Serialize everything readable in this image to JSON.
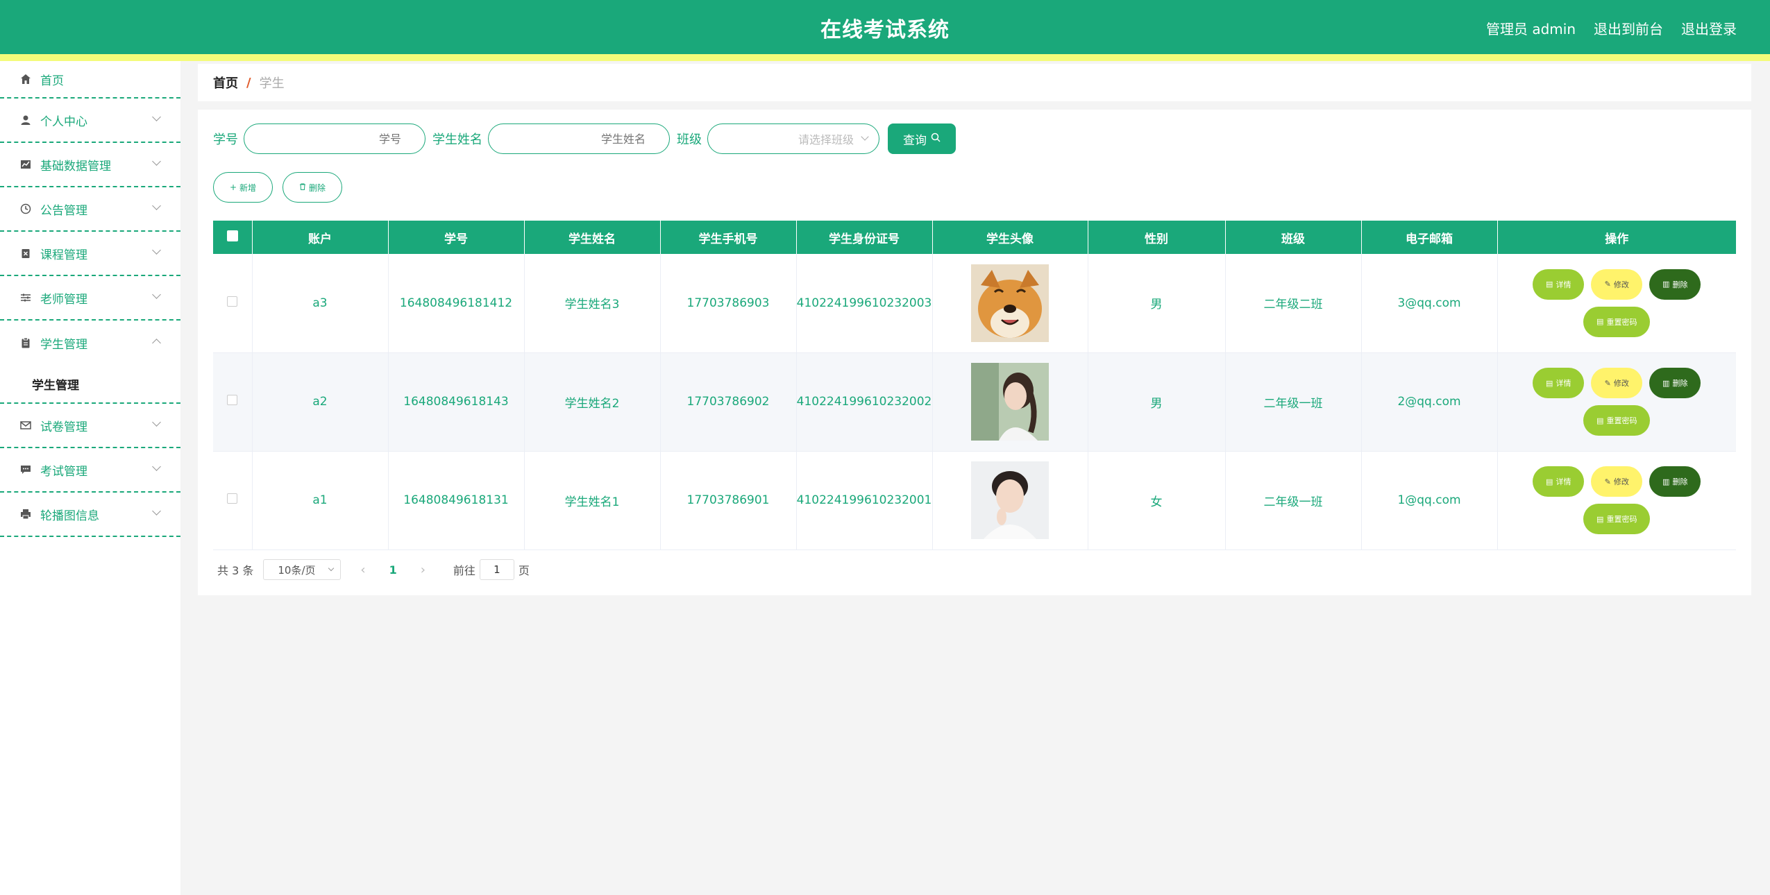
{
  "header": {
    "title": "在线考试系统",
    "links": [
      "管理员 admin",
      "退出到前台",
      "退出登录"
    ]
  },
  "sidebar": {
    "items": [
      {
        "label": "首页",
        "icon": "home-icon"
      },
      {
        "label": "个人中心",
        "icon": "user-icon"
      },
      {
        "label": "基础数据管理",
        "icon": "chart-icon"
      },
      {
        "label": "公告管理",
        "icon": "clock-icon"
      },
      {
        "label": "课程管理",
        "icon": "delete-doc-icon"
      },
      {
        "label": "老师管理",
        "icon": "sliders-icon"
      },
      {
        "label": "学生管理",
        "icon": "clipboard-icon"
      },
      {
        "label": "试卷管理",
        "icon": "mail-icon"
      },
      {
        "label": "考试管理",
        "icon": "chat-icon"
      },
      {
        "label": "轮播图信息",
        "icon": "printer-icon"
      }
    ],
    "sub_item": "学生管理"
  },
  "breadcrumb": {
    "home": "首页",
    "sep": "/",
    "current": "学生"
  },
  "search": {
    "label_id": "学号",
    "placeholder_id": "学号",
    "label_name": "学生姓名",
    "placeholder_name": "学生姓名",
    "label_class": "班级",
    "placeholder_class": "请选择班级",
    "query": "查询"
  },
  "actions": {
    "add": "新增",
    "delete": "删除"
  },
  "table": {
    "headers": [
      "账户",
      "学号",
      "学生姓名",
      "学生手机号",
      "学生身份证号",
      "学生头像",
      "性别",
      "班级",
      "电子邮箱",
      "操作"
    ],
    "rows": [
      {
        "account": "a3",
        "id": "164808496181412",
        "name": "学生姓名3",
        "phone": "17703786903",
        "idcard": "410224199610232003",
        "avatar": "shiba-dog-photo",
        "gender": "男",
        "class": "二年级二班",
        "email": "3@qq.com"
      },
      {
        "account": "a2",
        "id": "16480849618143",
        "name": "学生姓名2",
        "phone": "17703786902",
        "idcard": "410224199610232002",
        "avatar": "girl-photo",
        "gender": "男",
        "class": "二年级一班",
        "email": "2@qq.com"
      },
      {
        "account": "a1",
        "id": "16480849618131",
        "name": "学生姓名1",
        "phone": "17703786901",
        "idcard": "410224199610232001",
        "avatar": "boy-photo",
        "gender": "女",
        "class": "二年级一班",
        "email": "1@qq.com"
      }
    ],
    "ops": {
      "detail": "详情",
      "edit": "修改",
      "delete": "删除",
      "reset": "重置密码"
    }
  },
  "pager": {
    "total": "共 3 条",
    "size": "10条/页",
    "page": "1",
    "goto": "前往",
    "goto_value": "1",
    "unit": "页"
  },
  "colors": {
    "primary": "#1aa87a",
    "stripe": "#f4fb7a",
    "detail": "#9acd32",
    "edit": "#fff36b",
    "delete": "#2e6a1c"
  }
}
